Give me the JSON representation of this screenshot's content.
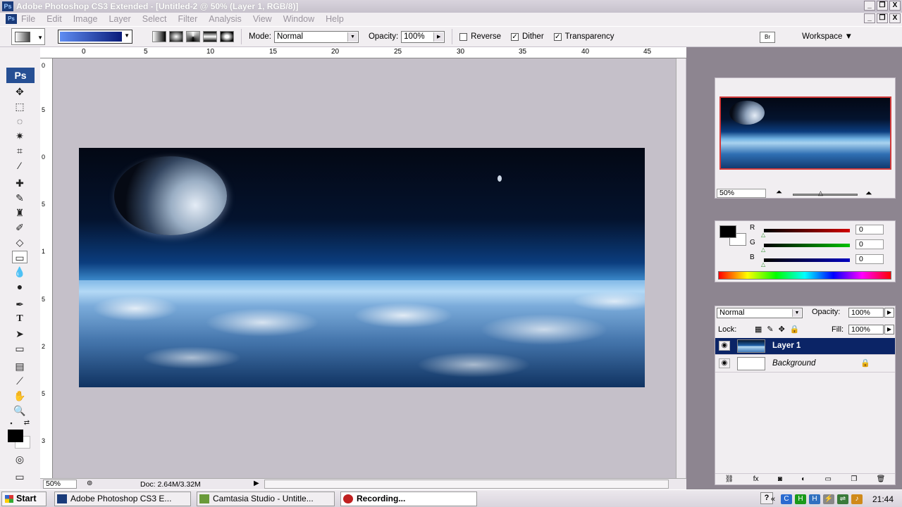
{
  "window": {
    "title": "Adobe Photoshop CS3 Extended - [Untitled-2 @ 50% (Layer 1, RGB/8)]",
    "controls": [
      "_",
      "❐",
      "X"
    ]
  },
  "menu": {
    "items": [
      "File",
      "Edit",
      "Image",
      "Layer",
      "Select",
      "Filter",
      "Analysis",
      "View",
      "Window",
      "Help"
    ]
  },
  "options": {
    "mode_label": "Mode:",
    "mode_value": "Normal",
    "opacity_label": "Opacity:",
    "opacity_value": "100%",
    "reverse_label": "Reverse",
    "reverse_checked": false,
    "dither_label": "Dither",
    "dither_checked": true,
    "transparency_label": "Transparency",
    "transparency_checked": true,
    "workspace_label": "Workspace ▼",
    "gradient_colors": [
      "#5f8df2",
      "#0a1c7a"
    ]
  },
  "toolbox": {
    "logo": "Ps"
  },
  "document": {
    "ruler_top": [
      "0",
      "5",
      "10",
      "15",
      "20",
      "25",
      "30",
      "35",
      "40",
      "45"
    ],
    "ruler_left": [
      "0",
      "5",
      "0",
      "5",
      "1",
      "5",
      "2",
      "5",
      "3"
    ],
    "zoom": "50%",
    "doc_info": "Doc: 2.64M/3.32M"
  },
  "navigator": {
    "zoom": "50%"
  },
  "color_panel": {
    "channels": [
      {
        "label": "R",
        "value": "0",
        "color": "#d00000"
      },
      {
        "label": "G",
        "value": "0",
        "color": "#00c000"
      },
      {
        "label": "B",
        "value": "0",
        "color": "#0000c0"
      }
    ]
  },
  "layers_panel": {
    "blend_mode": "Normal",
    "opacity_label": "Opacity:",
    "opacity_value": "100%",
    "lock_label": "Lock:",
    "fill_label": "Fill:",
    "fill_value": "100%",
    "layers": [
      {
        "name": "Layer 1",
        "selected": true
      },
      {
        "name": "Background",
        "selected": false,
        "locked": true
      }
    ]
  },
  "taskbar": {
    "start": "Start",
    "tasks": [
      {
        "label": "Adobe Photoshop CS3 E..."
      },
      {
        "label": "Camtasia Studio - Untitle..."
      },
      {
        "label": "Recording..."
      }
    ],
    "clock": "21:44"
  }
}
